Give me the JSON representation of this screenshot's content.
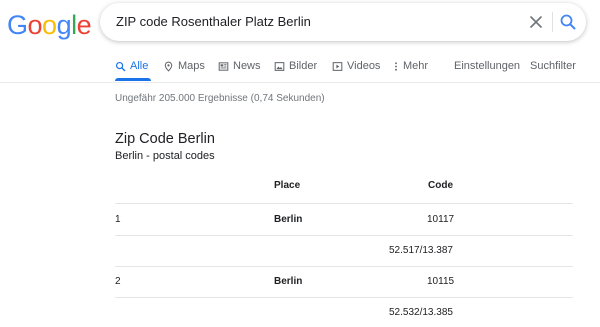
{
  "logo": {
    "letters": [
      "G",
      "o",
      "o",
      "g",
      "l",
      "e"
    ]
  },
  "colors": {
    "google_blue": "#4285f4",
    "google_red": "#ea4335",
    "google_yellow": "#fbbc05",
    "google_green": "#34a853",
    "active_tab": "#1a73e8",
    "muted": "#5f6368"
  },
  "search": {
    "query": "ZIP code Rosenthaler Platz Berlin"
  },
  "tabs": [
    {
      "label": "Alle",
      "icon": "search-icon",
      "active": true
    },
    {
      "label": "Maps",
      "icon": "map-pin-icon"
    },
    {
      "label": "News",
      "icon": "newspaper-icon"
    },
    {
      "label": "Bilder",
      "icon": "image-icon"
    },
    {
      "label": "Videos",
      "icon": "video-icon"
    },
    {
      "label": "Mehr",
      "icon": "more-vert-icon"
    }
  ],
  "tools": {
    "settings": "Einstellungen",
    "tools": "Suchfilter"
  },
  "stats": "Ungefähr 205.000 Ergebnisse (0,74 Sekunden)",
  "result": {
    "title": "Zip Code Berlin",
    "subtitle": "Berlin - postal codes",
    "columns": {
      "place": "Place",
      "code": "Code"
    },
    "rows": [
      {
        "num": "1",
        "place": "Berlin",
        "code": "10117",
        "coords": "52.517/13.387"
      },
      {
        "num": "2",
        "place": "Berlin",
        "code": "10115",
        "coords": "52.532/13.385"
      }
    ]
  }
}
